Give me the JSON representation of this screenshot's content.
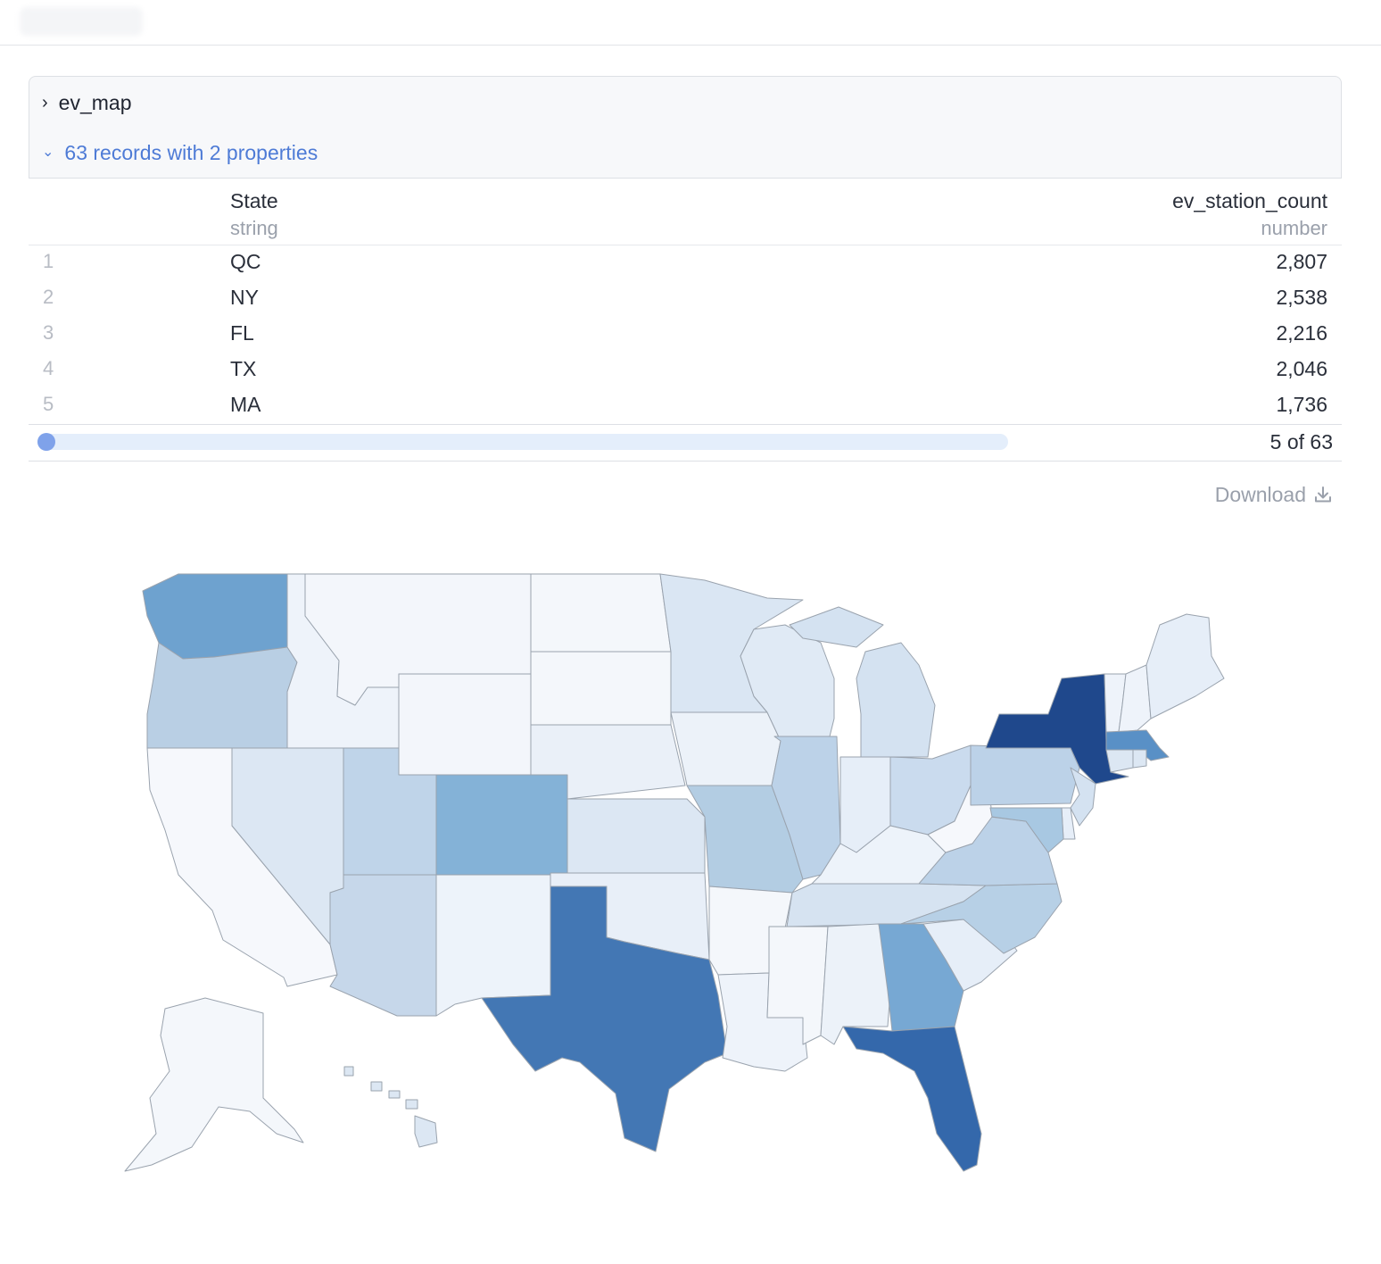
{
  "cell": {
    "name": "ev_map"
  },
  "summary": {
    "text": "63 records with 2 properties"
  },
  "columns": [
    {
      "name": "State",
      "type": "string"
    },
    {
      "name": "ev_station_count",
      "type": "number"
    }
  ],
  "rows": [
    {
      "index": "1",
      "state": "QC",
      "value": "2,807"
    },
    {
      "index": "2",
      "state": "NY",
      "value": "2,538"
    },
    {
      "index": "3",
      "state": "FL",
      "value": "2,216"
    },
    {
      "index": "4",
      "state": "TX",
      "value": "2,046"
    },
    {
      "index": "5",
      "state": "MA",
      "value": "1,736"
    }
  ],
  "pager": {
    "text": "5 of 63",
    "progress": 0.08
  },
  "download": {
    "label": "Download",
    "icon": "download-icon"
  },
  "map": {
    "type": "choropleth",
    "states": [
      {
        "id": "WA",
        "color": "#6ea2cf"
      },
      {
        "id": "OR",
        "color": "#b9cfe4"
      },
      {
        "id": "CA",
        "color": "#f6f8fc"
      },
      {
        "id": "NV",
        "color": "#dce7f3"
      },
      {
        "id": "ID",
        "color": "#eef3fa"
      },
      {
        "id": "MT",
        "color": "#f3f6fb"
      },
      {
        "id": "WY",
        "color": "#f3f6fb"
      },
      {
        "id": "UT",
        "color": "#bfd4e9"
      },
      {
        "id": "AZ",
        "color": "#c6d7ea"
      },
      {
        "id": "CO",
        "color": "#84b2d7"
      },
      {
        "id": "NM",
        "color": "#edf3fa"
      },
      {
        "id": "ND",
        "color": "#f4f7fb"
      },
      {
        "id": "SD",
        "color": "#f4f7fb"
      },
      {
        "id": "NE",
        "color": "#eaf0f8"
      },
      {
        "id": "KS",
        "color": "#dce7f3"
      },
      {
        "id": "OK",
        "color": "#e8eff8"
      },
      {
        "id": "TX",
        "color": "#4377b4"
      },
      {
        "id": "MN",
        "color": "#dae6f3"
      },
      {
        "id": "IA",
        "color": "#ecf2f9"
      },
      {
        "id": "MO",
        "color": "#b3cde3"
      },
      {
        "id": "AR",
        "color": "#f4f7fb"
      },
      {
        "id": "LA",
        "color": "#eef3fa"
      },
      {
        "id": "WI",
        "color": "#e0eaf5"
      },
      {
        "id": "IL",
        "color": "#bcd2e8"
      },
      {
        "id": "MI",
        "color": "#d4e2f1"
      },
      {
        "id": "IN",
        "color": "#e6eef8"
      },
      {
        "id": "OH",
        "color": "#cadbee"
      },
      {
        "id": "KY",
        "color": "#edf3fa"
      },
      {
        "id": "TN",
        "color": "#d6e3f1"
      },
      {
        "id": "MS",
        "color": "#f4f7fb"
      },
      {
        "id": "AL",
        "color": "#ecf2f9"
      },
      {
        "id": "GA",
        "color": "#77a8d3"
      },
      {
        "id": "FL",
        "color": "#3468ab"
      },
      {
        "id": "SC",
        "color": "#e6eef8"
      },
      {
        "id": "NC",
        "color": "#b7d0e6"
      },
      {
        "id": "VA",
        "color": "#bcd2e8"
      },
      {
        "id": "WV",
        "color": "#f6f8fc"
      },
      {
        "id": "PA",
        "color": "#bcd2e8"
      },
      {
        "id": "NY",
        "color": "#1f488c"
      },
      {
        "id": "VT",
        "color": "#eef3fa"
      },
      {
        "id": "NH",
        "color": "#eef3fa"
      },
      {
        "id": "ME",
        "color": "#e6eef8"
      },
      {
        "id": "MA",
        "color": "#5990c6"
      },
      {
        "id": "CT",
        "color": "#dce7f3"
      },
      {
        "id": "RI",
        "color": "#dce7f3"
      },
      {
        "id": "NJ",
        "color": "#d4e2f1"
      },
      {
        "id": "DE",
        "color": "#e6eef8"
      },
      {
        "id": "MD",
        "color": "#a8c8e2"
      },
      {
        "id": "AK",
        "color": "#f4f7fb"
      },
      {
        "id": "HI",
        "color": "#dce7f3"
      }
    ]
  }
}
